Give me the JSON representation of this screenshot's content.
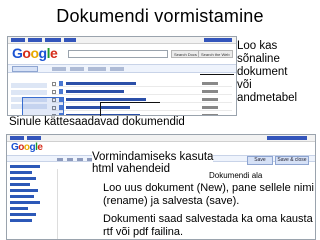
{
  "slide": {
    "title": "Dokumendi vormistamine"
  },
  "screenshot_top": {
    "logo": [
      "G",
      "o",
      "o",
      "g",
      "l",
      "e"
    ],
    "search_button_labels": [
      "Search Docs",
      "Search the Web"
    ]
  },
  "annotations": {
    "create_docs": [
      "Loo kas",
      "sõnaline",
      "dokument",
      "või",
      "andmetabel"
    ],
    "saved_docs": "Sinule kättesaadavad dokumendid",
    "formatting": [
      "Vormindamiseks kasuta",
      "html vahendeid"
    ],
    "doc_field": "Dokumendi ala",
    "new_doc": [
      "Loo uus dokument (New), pane sellele nimi",
      "(rename) ja salvesta (save)."
    ],
    "save_to_pc": [
      "Dokumenti saad salvestada ka oma kausta",
      "rtf või pdf failina."
    ]
  },
  "screenshot_bottom": {
    "logo": [
      "G",
      "o",
      "o",
      "g",
      "l",
      "e"
    ],
    "save_labels": [
      "Save",
      "Save & close"
    ]
  },
  "colors": {
    "google_blue": "#1a53d3",
    "google_red": "#d62c1a",
    "google_yellow": "#e8a900",
    "google_green": "#1c9a2e"
  }
}
